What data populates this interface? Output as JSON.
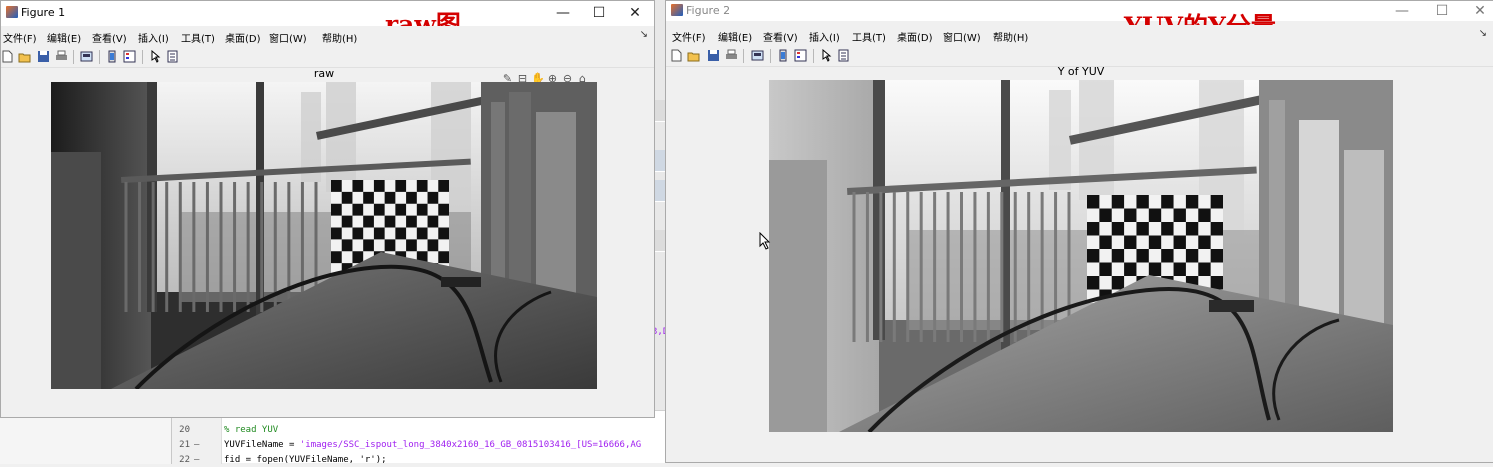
{
  "editor": {
    "lines": [
      {
        "num": "20",
        "mark": "",
        "text": "% read YUV",
        "kind": "comment"
      },
      {
        "num": "21",
        "mark": "—",
        "text": "YUVFileName = ",
        "string": "'images/SSC_ispout_long_3840x2160_16_GB_0815103416_[US=16666,AG",
        "kind": "code"
      },
      {
        "num": "22",
        "mark": "—",
        "text": "fid = fopen(YUVFileName, 'r');",
        "kind": "code"
      }
    ],
    "clipped_text": "3,D"
  },
  "figure1": {
    "window_title": "Figure 1",
    "annotation": "raw图",
    "menu": [
      "文件(F)",
      "编辑(E)",
      "查看(V)",
      "插入(I)",
      "工具(T)",
      "桌面(D)",
      "窗口(W)",
      "帮助(H)"
    ],
    "axes_title": "raw",
    "image_label": "grayscale raw image of a room with a checkerboard calibration target"
  },
  "figure2": {
    "window_title": "Figure 2",
    "annotation": "YUV的Y分量",
    "menu": [
      "文件(F)",
      "编辑(E)",
      "查看(V)",
      "插入(I)",
      "工具(T)",
      "桌面(D)",
      "窗口(W)",
      "帮助(H)"
    ],
    "axes_title": "Y of YUV",
    "image_label": "grayscale Y channel image of the same scene"
  },
  "window_buttons": {
    "minimize": "—",
    "maximize": "☐",
    "close": "✕"
  },
  "menu_pin": "↘",
  "colors": {
    "annotation_red": "#d40000",
    "titlebar_white": "#ffffff",
    "figure_bg": "#f0f0f0"
  }
}
